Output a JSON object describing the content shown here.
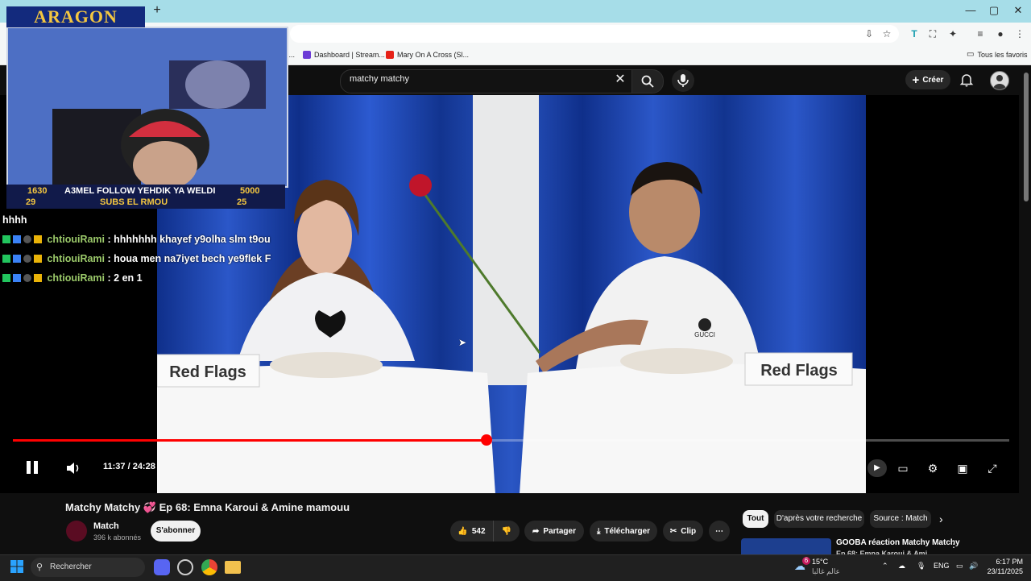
{
  "browser": {
    "new_tab_label": "+",
    "window_controls": [
      "—",
      "▢",
      "✕"
    ],
    "bookmarks": [
      {
        "label": "si...",
        "icon_color": "#888888"
      },
      {
        "label": "Dashboard | Stream...",
        "icon_color": "#6c3bd6"
      },
      {
        "label": "Mary On A Cross (Sl...",
        "icon_color": "#e62117"
      }
    ],
    "all_favorites_label": "Tous les favoris"
  },
  "youtube": {
    "search_value": "matchy matchy",
    "create_label": "Créer",
    "player": {
      "time_current": "11:37",
      "time_total": "24:28",
      "time_display": "11:37 / 24:28",
      "progress_fraction": 0.475,
      "state": "playing",
      "sign_left": "Red Flags",
      "sign_right": "Red Flags",
      "shirt_logo": "GUCCI"
    },
    "video": {
      "title_prefix": "Matchy Matchy",
      "title_suffix": "Ep 68: Emna Karoui & Amine mamouu",
      "channel_name": "Match",
      "subscriber_count": "396 k abonnés",
      "subscribe_label": "S'abonner",
      "like_count": "542",
      "share_label": "Partager",
      "download_label": "Télécharger",
      "clip_label": "Clip"
    },
    "filter_chips": [
      "Tout",
      "D'après votre recherche",
      "Source : Match"
    ],
    "related": {
      "title": "GOOBA réaction Matchy Matchy",
      "subtitle": "Ep 68: Emna Karoui & Ami..."
    }
  },
  "overlay": {
    "brand_title": "ARAGON",
    "ticker_left_top": "1630",
    "ticker_left_bottom": "29",
    "ticker_message_top": "A3MEL FOLLOW YEHDIK YA WELDI",
    "ticker_message_bottom": "SUBS EL RMOU",
    "ticker_right_top": "5000",
    "ticker_right_bottom": "25",
    "chat_first_line": "hhhh",
    "chat": [
      {
        "user": "chtiouiRami",
        "message": ": hhhhhhh khayef y9olha slm t9ou"
      },
      {
        "user": "chtiouiRami",
        "message": ": houa men na7iyet bech ye9flek F"
      },
      {
        "user": "chtiouiRami",
        "message": ": 2 en 1"
      }
    ]
  },
  "taskbar": {
    "search_placeholder": "Rechercher",
    "weather_temp": "15°C",
    "weather_text": "عالم غالبا",
    "notif_count": "6",
    "language": "ENG",
    "time": "6:17 PM",
    "date": "23/11/2025"
  },
  "colors": {
    "youtube_red": "#ff0000",
    "tab_strip": "#a6dde8",
    "overlay_gold": "#f3c640",
    "chat_user_color": "#9bc96a"
  }
}
